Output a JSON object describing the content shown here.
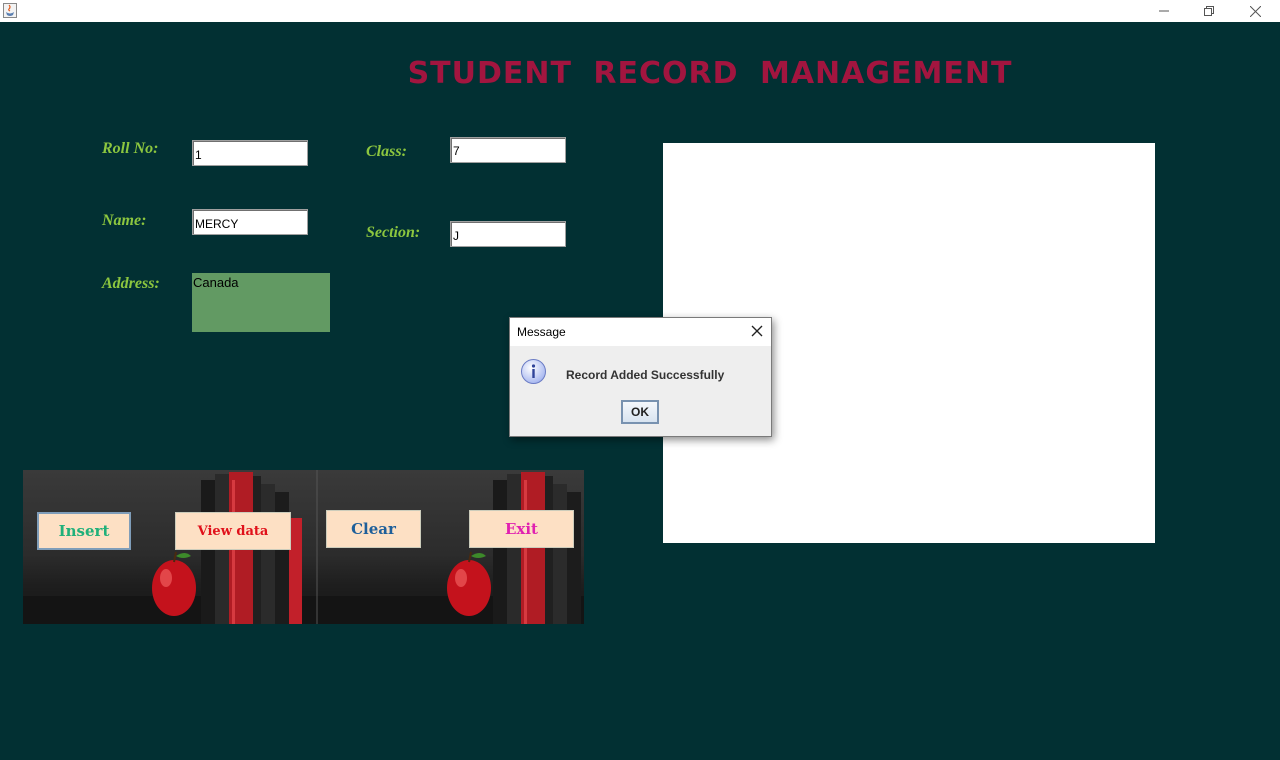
{
  "window": {
    "icon": "java-cup-icon",
    "controls": [
      "minimize-icon",
      "restore-icon",
      "close-icon"
    ]
  },
  "app": {
    "title": "STUDENT  RECORD MANAGEMENT",
    "title_color": "#a2153f",
    "background": "#023033",
    "label_color": "#8cc63f"
  },
  "form": {
    "roll_label": "Roll No:",
    "roll_value": "1",
    "class_label": "Class:",
    "class_value": "7",
    "name_label": "Name:",
    "name_value": "MERCY",
    "section_label": "Section:",
    "section_value": "J",
    "address_label": "Address:",
    "address_value": "Canada"
  },
  "buttons": {
    "insert": {
      "label": "Insert",
      "color": "#20b07a"
    },
    "view": {
      "label": "View data",
      "color": "#e0101a"
    },
    "clear": {
      "label": "Clear",
      "color": "#1e5f9a"
    },
    "exit": {
      "label": "Exit",
      "color": "#e020b0"
    }
  },
  "dialog": {
    "title": "Message",
    "message": "Record Added Successfully",
    "ok_label": "OK",
    "icon": "info-icon"
  }
}
